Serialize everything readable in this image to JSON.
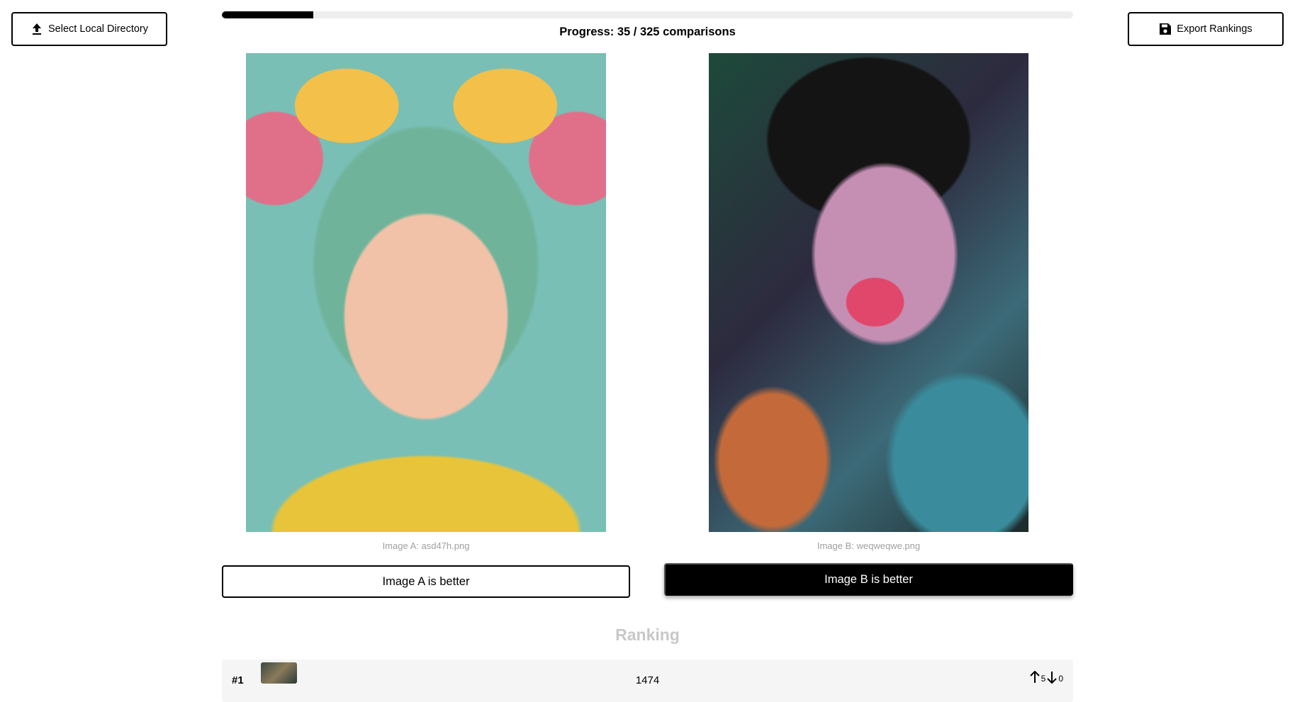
{
  "header": {
    "select_dir_label": "Select Local Directory",
    "export_label": "Export Rankings",
    "select_dir_icon": "upload-icon",
    "export_icon": "floppy-disk-icon"
  },
  "progress": {
    "text": "Progress: 35 / 325 comparisons",
    "completed": 35,
    "total": 325,
    "fraction": 0.1077
  },
  "comparison": {
    "image_a_caption": "Image A: asd47h.png",
    "image_b_caption": "Image B: weqweqwe.png",
    "button_a_label": "Image A is better",
    "button_b_label": "Image B is better"
  },
  "ranking": {
    "title": "Ranking",
    "rows": [
      {
        "rank": "#1",
        "score": "1474",
        "up_votes": "5",
        "down_votes": "0"
      }
    ]
  },
  "colors": {
    "accent": "#000000",
    "progress_track": "#eeeeee",
    "caption": "#a0a0a0",
    "ranking_title": "#c8c8c8",
    "row_background": "#f5f5f5"
  }
}
